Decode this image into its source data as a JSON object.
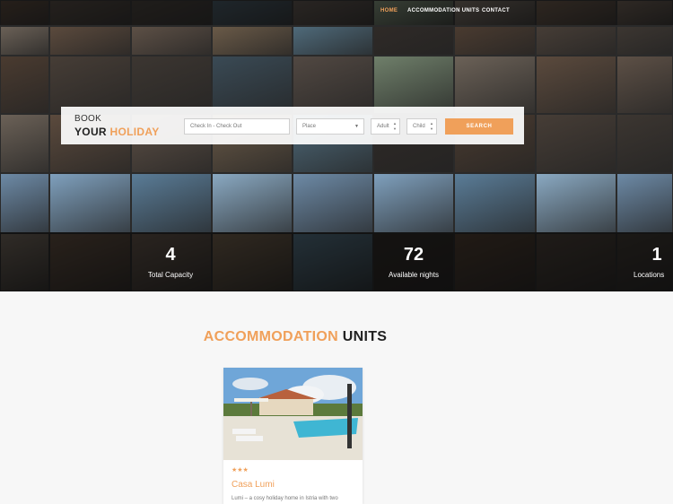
{
  "nav": {
    "items": [
      {
        "label": "HOME",
        "active": true
      },
      {
        "label": "ACCOMMODATION UNITS",
        "active": false
      },
      {
        "label": "CONTACT",
        "active": false
      }
    ]
  },
  "booking": {
    "title_line1": "BOOK",
    "title_line2_a": "YOUR",
    "title_line2_b": "HOLIDAY",
    "dates_placeholder": "Check In - Check Out",
    "place_placeholder": "Place",
    "adults_placeholder": "Adult",
    "child_placeholder": "Child",
    "search_label": "SEARCH"
  },
  "stats": [
    {
      "value": "4",
      "label": "Total Capacity"
    },
    {
      "value": "72",
      "label": "Available nights"
    },
    {
      "value": "1",
      "label": "Locations"
    }
  ],
  "section": {
    "title_a": "ACCOMMODATION",
    "title_b": "UNITS"
  },
  "card": {
    "stars": "★★★",
    "title": "Casa Lumi",
    "description": "Lumi – a cosy holiday home in Istria with two"
  },
  "colors": {
    "accent": "#f0a05a",
    "dark": "#222222"
  }
}
